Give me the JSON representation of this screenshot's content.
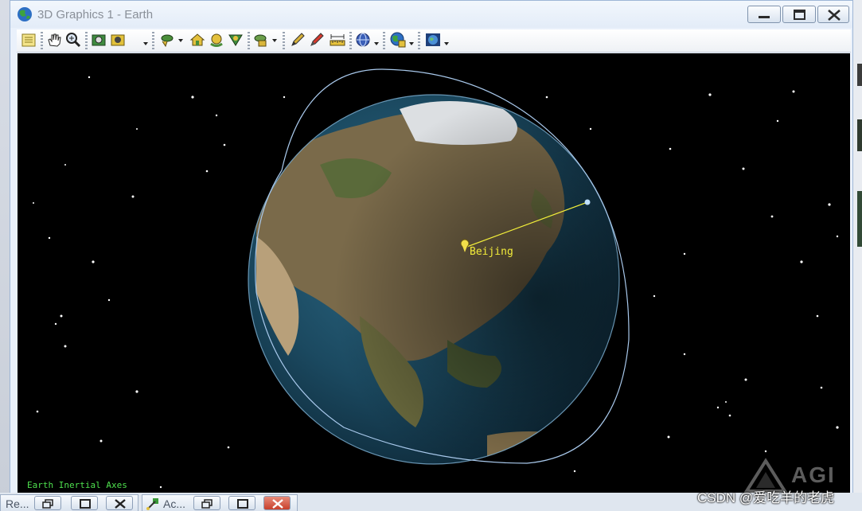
{
  "window": {
    "title": "3D Graphics 1 - Earth",
    "controls": [
      "minimize",
      "maximize",
      "close"
    ]
  },
  "toolbar": {
    "icons": [
      "properties-icon",
      "pan-hand-icon",
      "zoom-icon",
      "camera-icon",
      "snapshot-icon",
      "view-from-icon",
      "home-view-icon",
      "orbit-view-icon",
      "zoom-to-icon",
      "object-view-icon",
      "pencil-icon",
      "marker-icon",
      "ruler-icon",
      "globe-grid-icon",
      "globe-manager-icon",
      "globe-3d-icon"
    ]
  },
  "scene": {
    "axes_label": "Earth Inertial Axes",
    "place_label": "Beijing",
    "watermark": "AGI",
    "colors": {
      "background": "#000000",
      "orbit": "#a9c9ec",
      "access_line": "#f2ee3a",
      "axes_label": "#4ee04e",
      "place_label": "#f3ec3a"
    }
  },
  "taskbar": {
    "items": [
      {
        "label": "Re..."
      },
      {
        "label": "Ac..."
      }
    ]
  },
  "footer": {
    "watermark_text": "CSDN @爱吃羊的老虎"
  }
}
